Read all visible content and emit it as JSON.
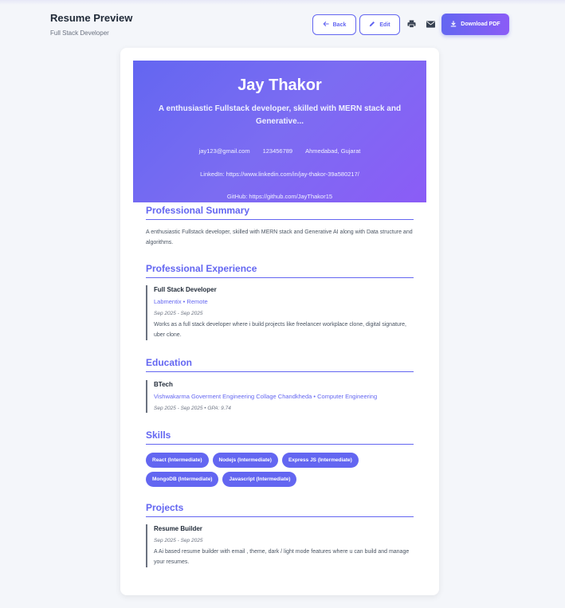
{
  "page": {
    "title": "Resume Preview",
    "subtitle": "Full Stack Developer"
  },
  "toolbar": {
    "back_label": "Back",
    "edit_label": "Edit",
    "download_label": "Download PDF"
  },
  "icons": {
    "back": "arrow-left-icon",
    "edit": "pencil-icon",
    "print": "printer-icon",
    "mail": "mail-icon",
    "download": "download-icon"
  },
  "colors": {
    "accent": "#6366f1",
    "accent_gradient_end": "#8b5cf6",
    "background": "#f4f6fa"
  },
  "resume": {
    "name": "Jay Thakor",
    "headline": "A enthusiastic Fullstack developer, skilled with MERN stack and Generative...",
    "email": "jay123@gmail.com",
    "phone": "123456789",
    "location": "Ahmedabad, Gujarat",
    "linkedin": "LinkedIn: https://www.linkedin.com/in/jay-thakor-39a580217/",
    "github": "GitHub: https://github.com/JayThakor15",
    "summary": {
      "title": "Professional Summary",
      "text": "A enthusiastic Fullstack developer, skilled with MERN stack and Generative AI along with Data structure and algorithms."
    },
    "experience": {
      "title": "Professional Experience",
      "items": [
        {
          "role": "Full Stack Developer",
          "company": "Labmentix • Remote",
          "dates": "Sep 2025 - Sep 2025",
          "description": "Works as a full stack developer where i build projects like freelancer workplace clone, digital signature, uber clone."
        }
      ]
    },
    "education": {
      "title": "Education",
      "items": [
        {
          "degree": "BTech",
          "institution": "Vishwakarma Goverment Engineering Collage Chandkheda • Computer Engineering",
          "details": "Sep 2025 - Sep 2025 • GPA: 9.74"
        }
      ]
    },
    "skills": {
      "title": "Skills",
      "items": [
        "React (Intermediate)",
        "Nodejs (Intermediate)",
        "Express JS (Intermediate)",
        "MongoDB (Intermediate)",
        "Javascript (Intermediate)"
      ]
    },
    "projects": {
      "title": "Projects",
      "items": [
        {
          "name": "Resume Builder",
          "dates": "Sep 2025 - Sep 2025",
          "description": "A Ai based resume builder with email , theme, dark / light mode features where u can build and manage your resumes."
        }
      ]
    }
  }
}
